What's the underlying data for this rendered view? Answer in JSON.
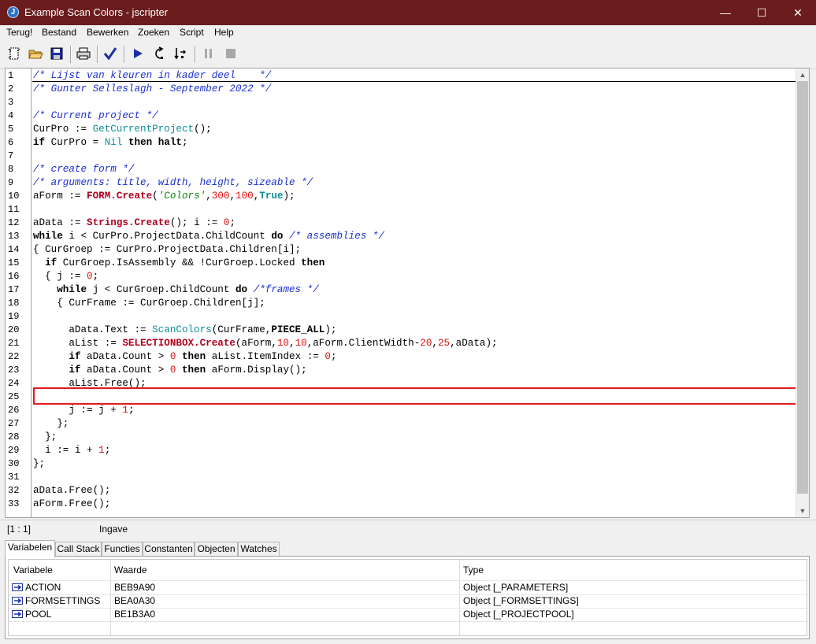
{
  "window": {
    "title": "Example Scan Colors - jscripter",
    "minimize": "—",
    "maximize": "☐",
    "close": "✕"
  },
  "menu": [
    "Terug!",
    "Bestand",
    "Bewerken",
    "Zoeken",
    "Script",
    "Help"
  ],
  "toolbar": {
    "icons": [
      "new-file-icon",
      "open-folder-icon",
      "save-icon",
      "print-icon",
      "check-syntax-icon",
      "run-icon",
      "step-into-icon",
      "step-over-icon",
      "pause-icon",
      "stop-icon"
    ]
  },
  "editor": {
    "line_numbers": [
      "1",
      "2",
      "3",
      "4",
      "5",
      "6",
      "7",
      "8",
      "9",
      "10",
      "11",
      "12",
      "13",
      "14",
      "15",
      "16",
      "17",
      "18",
      "19",
      "20",
      "21",
      "22",
      "23",
      "24",
      "25",
      "26",
      "27",
      "28",
      "29",
      "30",
      "31",
      "32",
      "33"
    ],
    "highlighted_line": "20",
    "highlight_color": "#e01b1b",
    "code": [
      [
        {
          "t": "/* Lijst van kleuren in kader deel    */",
          "c": "c-comment"
        }
      ],
      [
        {
          "t": "/* Gunter Selleslagh - September 2022 */",
          "c": "c-comment"
        }
      ],
      [],
      [
        {
          "t": "/* Current project */",
          "c": "c-comment"
        }
      ],
      [
        {
          "t": "CurPro := "
        },
        {
          "t": "GetCurrentProject",
          "c": "c-fn"
        },
        {
          "t": "();"
        }
      ],
      [
        {
          "t": "if",
          "c": "c-kw"
        },
        {
          "t": " CurPro = "
        },
        {
          "t": "Nil",
          "c": "c-fn"
        },
        {
          "t": " "
        },
        {
          "t": "then halt",
          "c": "c-kw"
        },
        {
          "t": ";"
        }
      ],
      [],
      [
        {
          "t": "/* create form */",
          "c": "c-comment"
        }
      ],
      [
        {
          "t": "/* arguments: title, width, height, sizeable */",
          "c": "c-comment"
        }
      ],
      [
        {
          "t": "aForm := "
        },
        {
          "t": "FORM.Create",
          "c": "c-cls"
        },
        {
          "t": "("
        },
        {
          "t": "'Colors'",
          "c": "c-str"
        },
        {
          "t": ","
        },
        {
          "t": "300",
          "c": "c-num"
        },
        {
          "t": ","
        },
        {
          "t": "100",
          "c": "c-num"
        },
        {
          "t": ","
        },
        {
          "t": "True",
          "c": "c-bool"
        },
        {
          "t": ");"
        }
      ],
      [],
      [
        {
          "t": "aData := "
        },
        {
          "t": "Strings.Create",
          "c": "c-cls"
        },
        {
          "t": "(); i := "
        },
        {
          "t": "0",
          "c": "c-num"
        },
        {
          "t": ";"
        }
      ],
      [
        {
          "t": "while",
          "c": "c-kw"
        },
        {
          "t": " i < CurPro.ProjectData.ChildCount "
        },
        {
          "t": "do",
          "c": "c-kw"
        },
        {
          "t": " "
        },
        {
          "t": "/* assemblies */",
          "c": "c-comment"
        }
      ],
      [
        {
          "t": "{ CurGroep := CurPro.ProjectData.Children[i];"
        }
      ],
      [
        {
          "t": "  "
        },
        {
          "t": "if",
          "c": "c-kw"
        },
        {
          "t": " CurGroep.IsAssembly && !CurGroep.Locked "
        },
        {
          "t": "then",
          "c": "c-kw"
        }
      ],
      [
        {
          "t": "  { j := "
        },
        {
          "t": "0",
          "c": "c-num"
        },
        {
          "t": ";"
        }
      ],
      [
        {
          "t": "    "
        },
        {
          "t": "while",
          "c": "c-kw"
        },
        {
          "t": " j < CurGroep.ChildCount "
        },
        {
          "t": "do",
          "c": "c-kw"
        },
        {
          "t": " "
        },
        {
          "t": "/*frames */",
          "c": "c-comment"
        }
      ],
      [
        {
          "t": "    { CurFrame := CurGroep.Children[j];"
        }
      ],
      [],
      [
        {
          "t": "      aData.Text := "
        },
        {
          "t": "ScanColors",
          "c": "c-fn"
        },
        {
          "t": "(CurFrame,"
        },
        {
          "t": "PIECE_ALL",
          "c": "c-kw"
        },
        {
          "t": ");"
        }
      ],
      [
        {
          "t": "      aList := "
        },
        {
          "t": "SELECTIONBOX.Create",
          "c": "c-cls"
        },
        {
          "t": "(aForm,"
        },
        {
          "t": "10",
          "c": "c-num"
        },
        {
          "t": ","
        },
        {
          "t": "10",
          "c": "c-num"
        },
        {
          "t": ",aForm.ClientWidth-"
        },
        {
          "t": "20",
          "c": "c-num"
        },
        {
          "t": ","
        },
        {
          "t": "25",
          "c": "c-num"
        },
        {
          "t": ",aData);"
        }
      ],
      [
        {
          "t": "      "
        },
        {
          "t": "if",
          "c": "c-kw"
        },
        {
          "t": " aData.Count > "
        },
        {
          "t": "0",
          "c": "c-num"
        },
        {
          "t": " "
        },
        {
          "t": "then",
          "c": "c-kw"
        },
        {
          "t": " aList.ItemIndex := "
        },
        {
          "t": "0",
          "c": "c-num"
        },
        {
          "t": ";"
        }
      ],
      [
        {
          "t": "      "
        },
        {
          "t": "if",
          "c": "c-kw"
        },
        {
          "t": " aData.Count > "
        },
        {
          "t": "0",
          "c": "c-num"
        },
        {
          "t": " "
        },
        {
          "t": "then",
          "c": "c-kw"
        },
        {
          "t": " aForm.Display();"
        }
      ],
      [
        {
          "t": "      aList.Free();"
        }
      ],
      [],
      [
        {
          "t": "      j := j + "
        },
        {
          "t": "1",
          "c": "c-num"
        },
        {
          "t": ";"
        }
      ],
      [
        {
          "t": "    };"
        }
      ],
      [
        {
          "t": "  };"
        }
      ],
      [
        {
          "t": "  i := i + "
        },
        {
          "t": "1",
          "c": "c-num"
        },
        {
          "t": ";"
        }
      ],
      [
        {
          "t": "};"
        }
      ],
      [],
      [
        {
          "t": "aData.Free();"
        }
      ],
      [
        {
          "t": "aForm.Free();"
        }
      ]
    ]
  },
  "status": {
    "position": "[1 : 1]",
    "mode": "Ingave"
  },
  "tabs": [
    "Variabelen",
    "Call Stack",
    "Functies",
    "Constanten",
    "Objecten",
    "Watches"
  ],
  "active_tab": "Variabelen",
  "variables": {
    "columns": [
      "Variabele",
      "Waarde",
      "Type"
    ],
    "rows": [
      {
        "name": "ACTION",
        "value": "BEB9A90",
        "type": "Object [_PARAMETERS]"
      },
      {
        "name": "FORMSETTINGS",
        "value": "BEA0A30",
        "type": "Object [_FORMSETTINGS]"
      },
      {
        "name": "POOL",
        "value": "BE1B3A0",
        "type": "Object [_PROJECTPOOL]"
      }
    ]
  }
}
